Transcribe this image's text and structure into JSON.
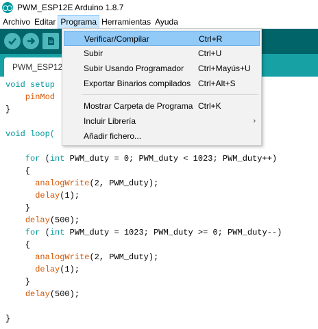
{
  "window": {
    "title": "PWM_ESP12E Arduino 1.8.7"
  },
  "menubar": {
    "items": [
      "Archivo",
      "Editar",
      "Programa",
      "Herramientas",
      "Ayuda"
    ]
  },
  "toolbar": {
    "buttons": [
      "verify-icon",
      "upload-icon",
      "new-icon"
    ]
  },
  "tabs": {
    "active": "PWM_ESP12"
  },
  "dropdown": {
    "items": [
      {
        "label": "Verificar/Compilar",
        "shortcut": "Ctrl+R"
      },
      {
        "label": "Subir",
        "shortcut": "Ctrl+U"
      },
      {
        "label": "Subir Usando Programador",
        "shortcut": "Ctrl+Mayús+U"
      },
      {
        "label": "Exportar Binarios compilados",
        "shortcut": "Ctrl+Alt+S"
      },
      {
        "label": "Mostrar Carpeta de Programa",
        "shortcut": "Ctrl+K"
      },
      {
        "label": "Incluir Librería",
        "shortcut": "",
        "submenu_arrow": "›"
      },
      {
        "label": "Añadir fichero...",
        "shortcut": ""
      }
    ]
  },
  "code": {
    "lines": [
      "void setup",
      "    pinMod",
      "}",
      "",
      "void loop(",
      "",
      "",
      "    for (int PWM_duty = 0; PWM_duty < 1023; PWM_duty++)",
      "    {",
      "      analogWrite(2, PWM_duty);",
      "      delay(1);",
      "    }",
      "    delay(500);",
      "    for (int PWM_duty = 1023; PWM_duty >= 0; PWM_duty--)",
      "    {",
      "      analogWrite(2, PWM_duty);",
      "      delay(1);",
      "    }",
      "    delay(500);",
      "",
      "}"
    ]
  },
  "colors": {
    "toolbar": "#006468",
    "tabstrip": "#17a1a5",
    "keyword": "#00979c",
    "function": "#d35400",
    "menu_highlight": "#91c9f7"
  }
}
